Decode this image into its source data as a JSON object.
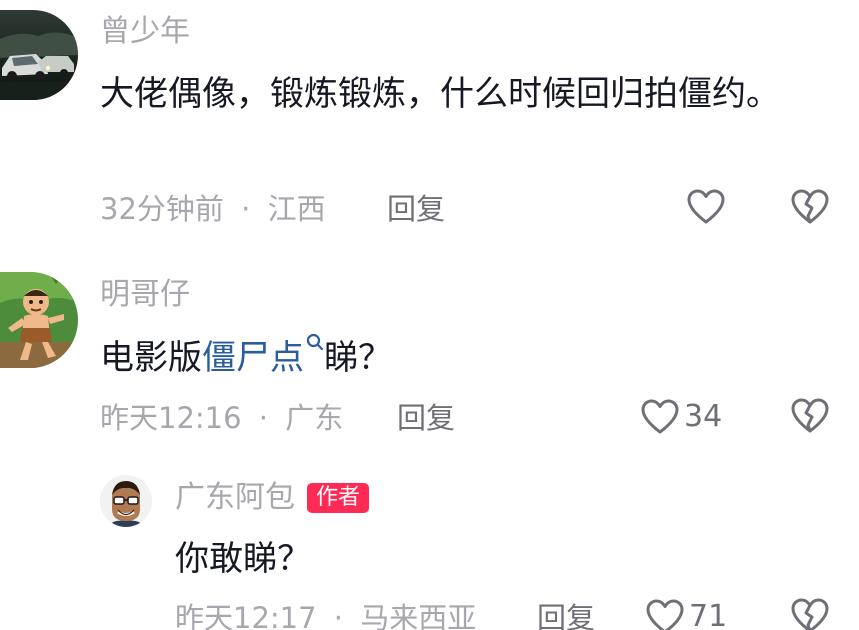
{
  "comments": [
    {
      "username": "曾少年",
      "text": "大佬偶像，锻炼锻炼，什么时候回归拍僵约。",
      "time": "32分钟前",
      "separator": "·",
      "location": "江西",
      "reply_label": "回复",
      "like_count": "",
      "avatar_icon": "car-photo-avatar"
    },
    {
      "username": "明哥仔",
      "text_before": "电影版",
      "link_text": "僵尸点",
      "text_after": "睇？",
      "time": "昨天12:16",
      "separator": "·",
      "location": "广东",
      "reply_label": "回复",
      "like_count": "34",
      "avatar_icon": "cartoon-caveman-avatar"
    }
  ],
  "reply": {
    "username": "广东阿包",
    "badge": "作者",
    "text": "你敢睇？",
    "time": "昨天12:17",
    "separator": "·",
    "location": "马来西亚",
    "reply_label": "回复",
    "like_count": "71",
    "avatar_icon": "cartoon-man-glasses-avatar"
  },
  "colors": {
    "username": "#a7a7ae",
    "text": "#161823",
    "link": "#2a5d9f",
    "badge": "#fe2c55",
    "icon": "#6f6f77"
  },
  "icons": {
    "like": "heart-outline-icon",
    "dislike": "broken-heart-icon",
    "search": "search-icon"
  }
}
